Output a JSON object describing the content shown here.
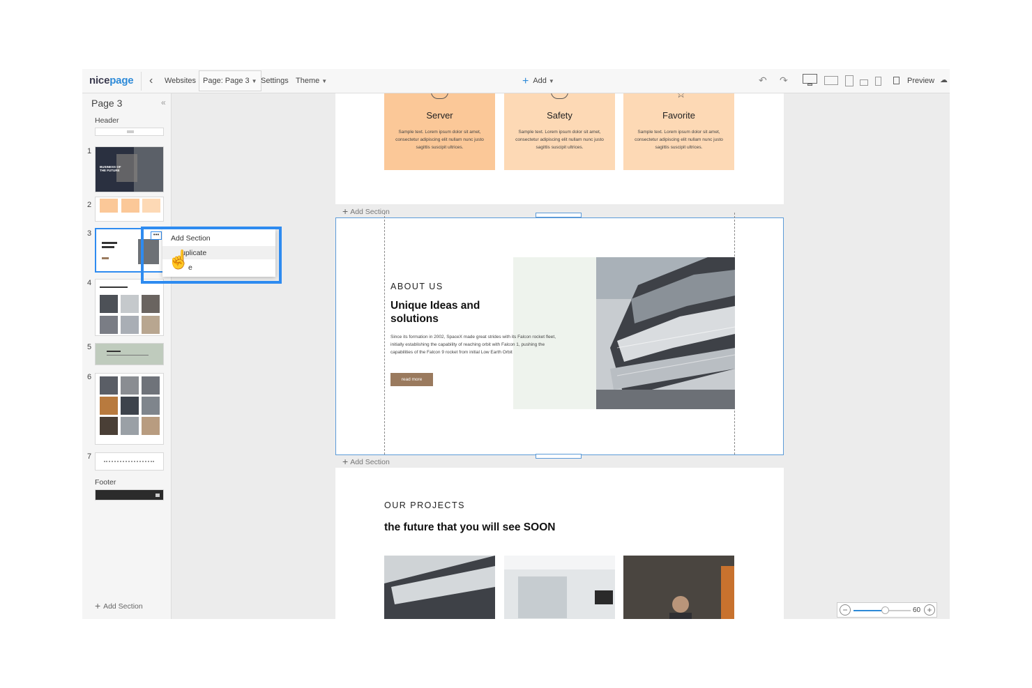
{
  "topbar": {
    "logo_main": "nice",
    "logo_accent": "page",
    "websites": "Websites",
    "page_selector": "Page: Page 3",
    "settings": "Settings",
    "theme": "Theme",
    "add": "Add",
    "preview": "Preview"
  },
  "sidebar": {
    "title": "Page 3",
    "header_label": "Header",
    "footer_label": "Footer",
    "add_section": "Add Section",
    "sections": [
      {
        "num": "1",
        "hero_text": "BUSINESS OF THE FUTURE"
      },
      {
        "num": "2"
      },
      {
        "num": "3"
      },
      {
        "num": "4"
      },
      {
        "num": "5"
      },
      {
        "num": "6"
      },
      {
        "num": "7"
      }
    ]
  },
  "context_menu": {
    "items": [
      "Add Section",
      "Duplicate",
      "Delete"
    ],
    "visible_items": [
      "Add Section",
      "uplicate",
      "e"
    ]
  },
  "canvas": {
    "cards": [
      {
        "title": "Server",
        "text": "Sample text. Lorem ipsum dolor sit amet, consectetur adipiscing elit nullam nunc justo sagittis suscipit ultrices."
      },
      {
        "title": "Safety",
        "text": "Sample text. Lorem ipsum dolor sit amet, consectetur adipiscing elit nullam nunc justo sagittis suscipit ultrices."
      },
      {
        "title": "Favorite",
        "text": "Sample text. Lorem ipsum dolor sit amet, consectetur adipiscing elit nullam nunc justo sagittis suscipit ultrices."
      }
    ],
    "add_section": "Add Section",
    "about": {
      "kicker": "ABOUT US",
      "heading": "Unique Ideas and solutions",
      "body": "Since its formation in 2002, SpaceX made great strides with its Falcon rocket fleet, initially establishing the capability of reaching orbit with Falcon 1, pushing the capabilities of the Falcon 9 rocket from initial Low Earth Orbit",
      "button": "read more"
    },
    "projects": {
      "kicker": "OUR PROJECTS",
      "heading": "the future that you will see SOON"
    }
  },
  "zoom": {
    "value": "60",
    "level_fraction": 0.55
  },
  "colors": {
    "accent": "#2d8ad8",
    "card": "#fbc898",
    "card_light": "#fdd9b5",
    "button": "#9a7a5e",
    "selection": "#2e8bf0"
  }
}
